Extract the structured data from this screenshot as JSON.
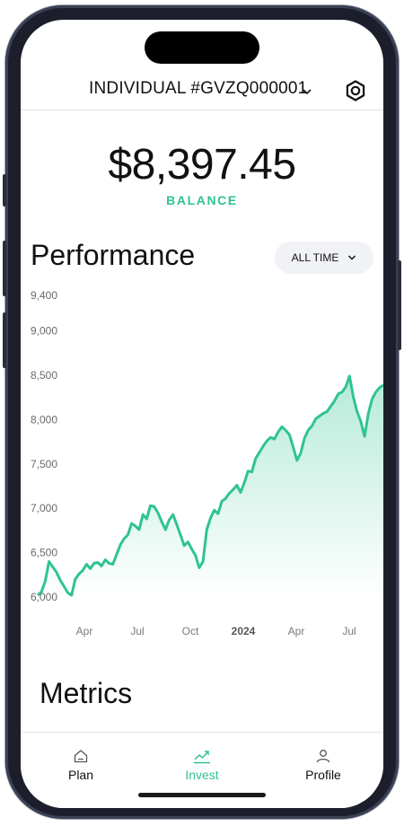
{
  "header": {
    "account_title": "INDIVIDUAL #GVZQ000001",
    "chevron_icon": "chevron-down-icon",
    "settings_icon": "gear-icon"
  },
  "balance": {
    "value": "$8,397.45",
    "label": "BALANCE"
  },
  "performance": {
    "title": "Performance",
    "range_label": "ALL TIME"
  },
  "chart_data": {
    "type": "area",
    "y_ticks": [
      "9,400",
      "9,000",
      "8,500",
      "8,000",
      "7,500",
      "7,000",
      "6,500",
      "6,000"
    ],
    "x_ticks": [
      {
        "label": "Apr",
        "bold": false
      },
      {
        "label": "Jul",
        "bold": false
      },
      {
        "label": "Oct",
        "bold": false
      },
      {
        "label": "2024",
        "bold": true
      },
      {
        "label": "Apr",
        "bold": false
      },
      {
        "label": "Jul",
        "bold": false
      }
    ],
    "ylim": [
      6000,
      9400
    ],
    "x_range": [
      "2023-02",
      "2024-09"
    ],
    "line_color": "#2fc490",
    "series": [
      {
        "values": [
          6020,
          6060,
          6180,
          6400,
          6340,
          6280,
          6190,
          6120,
          6050,
          6020,
          6200,
          6260,
          6300,
          6370,
          6320,
          6380,
          6390,
          6350,
          6420,
          6380,
          6370,
          6480,
          6590,
          6660,
          6700,
          6830,
          6800,
          6760,
          6930,
          6880,
          7030,
          7020,
          6950,
          6850,
          6760,
          6870,
          6930,
          6820,
          6700,
          6580,
          6620,
          6540,
          6470,
          6330,
          6400,
          6760,
          6890,
          6980,
          6940,
          7080,
          7110,
          7170,
          7210,
          7260,
          7180,
          7290,
          7420,
          7410,
          7560,
          7630,
          7700,
          7760,
          7800,
          7780,
          7860,
          7920,
          7880,
          7830,
          7690,
          7540,
          7620,
          7790,
          7880,
          7930,
          8010,
          8040,
          8070,
          8090,
          8150,
          8210,
          8290,
          8310,
          8370,
          8490,
          8260,
          8090,
          7980,
          7810,
          8070,
          8230,
          8310,
          8360,
          8390
        ]
      }
    ],
    "grid": false
  },
  "metrics": {
    "title": "Metrics"
  },
  "tab_bar": {
    "tabs": [
      {
        "label": "Plan",
        "icon": "home-icon",
        "active": false
      },
      {
        "label": "Invest",
        "icon": "chart-icon",
        "active": true
      },
      {
        "label": "Profile",
        "icon": "user-icon",
        "active": false
      }
    ]
  }
}
